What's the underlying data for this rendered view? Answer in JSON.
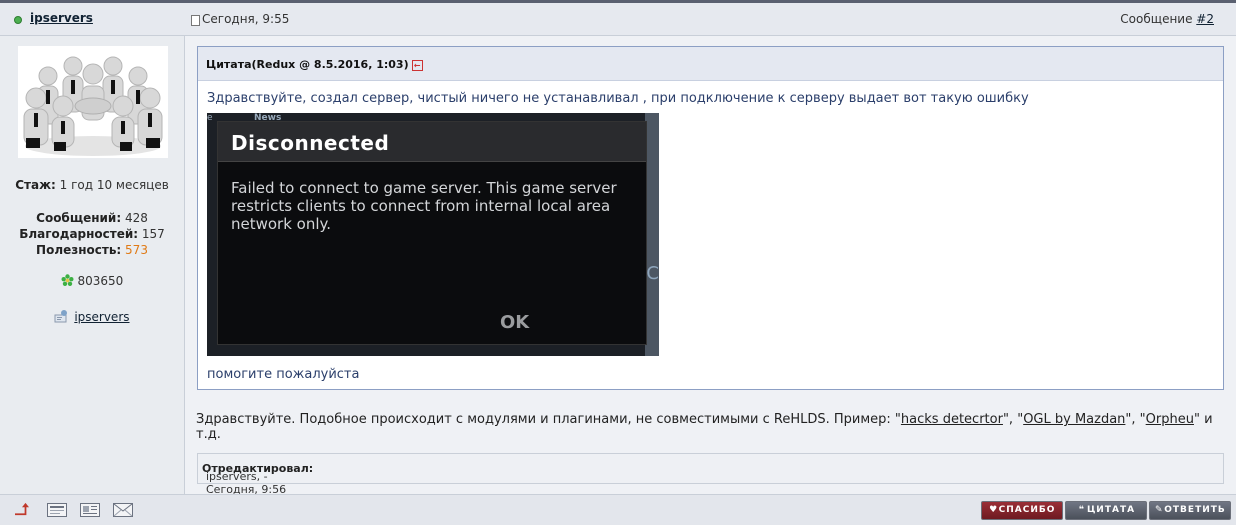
{
  "header": {
    "author": "ipservers",
    "date": "Сегодня, 9:55",
    "post_label": "Сообщение ",
    "post_number": "#2"
  },
  "sidebar": {
    "experience_label": "Стаж:",
    "experience_value": " 1 год 10 месяцев",
    "messages_label": "Сообщений:",
    "messages_value": " 428",
    "thanks_label": "Благодарностей:",
    "thanks_value": " 157",
    "usefulness_label": "Полезность:",
    "usefulness_value": " 573",
    "icq_number": "803650",
    "contact_name": "ipservers"
  },
  "quote": {
    "title": "Цитата(Redux @ 8.5.2016, 1:03)",
    "text": "Здравствуйте, создал сервер, чистый ничего не устанавливал , при подключение к серверу выдает вот такую ошибку",
    "after_text": "помогите пожалуйста",
    "screenshot": {
      "left_fragment": "е",
      "news": "News",
      "right_fragment": "С",
      "dialog_title": "Disconnected",
      "dialog_message": "Failed to connect to game server. This game server restricts clients to connect from internal local area network only.",
      "dialog_ok": "OK"
    }
  },
  "reply": {
    "text_before": "Здравствуйте. Подобное происходит с модулями и плагинами, не совместимыми с ReHLDS. Пример: \"",
    "link1": "hacks detecrtor",
    "sep1": "\", \"",
    "link2": "OGL by Mazdan",
    "sep2": "\", \"",
    "link3": "Orpheu",
    "text_after": "\" и т.д."
  },
  "edited": {
    "label": "Отредактировал:",
    "value": " ipservers, - Сегодня, 9:56"
  },
  "footer": {
    "thanks_button": "СПАСИБО",
    "quote_button": "ЦИТАТА",
    "reply_button": "ОТВЕТИТЬ"
  },
  "colors": {
    "accent_orange": "#e07a16",
    "quote_text": "#2b3f6b",
    "thanks_button": "#8a2630"
  }
}
